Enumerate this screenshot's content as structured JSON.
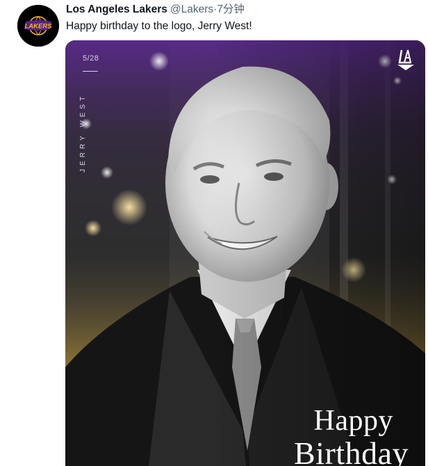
{
  "tweet": {
    "author_name": "Los Angeles Lakers",
    "handle": "@Lakers",
    "separator": "·",
    "time": "7分钟",
    "text": "Happy birthday to the logo, Jerry West!",
    "avatar_icon": "lakers-logo-icon",
    "avatar_logo_text": "LAKERS"
  },
  "media": {
    "date": "5/28",
    "vertical_name": "JERRY WEST",
    "happy": "Happy",
    "birthday": "Birthday",
    "corner_logo_icon": "la-monogram-icon"
  },
  "colors": {
    "lakers_purple": "#552583",
    "lakers_gold": "#FDB927",
    "text_primary": "#0f1419",
    "text_secondary": "#536471"
  }
}
